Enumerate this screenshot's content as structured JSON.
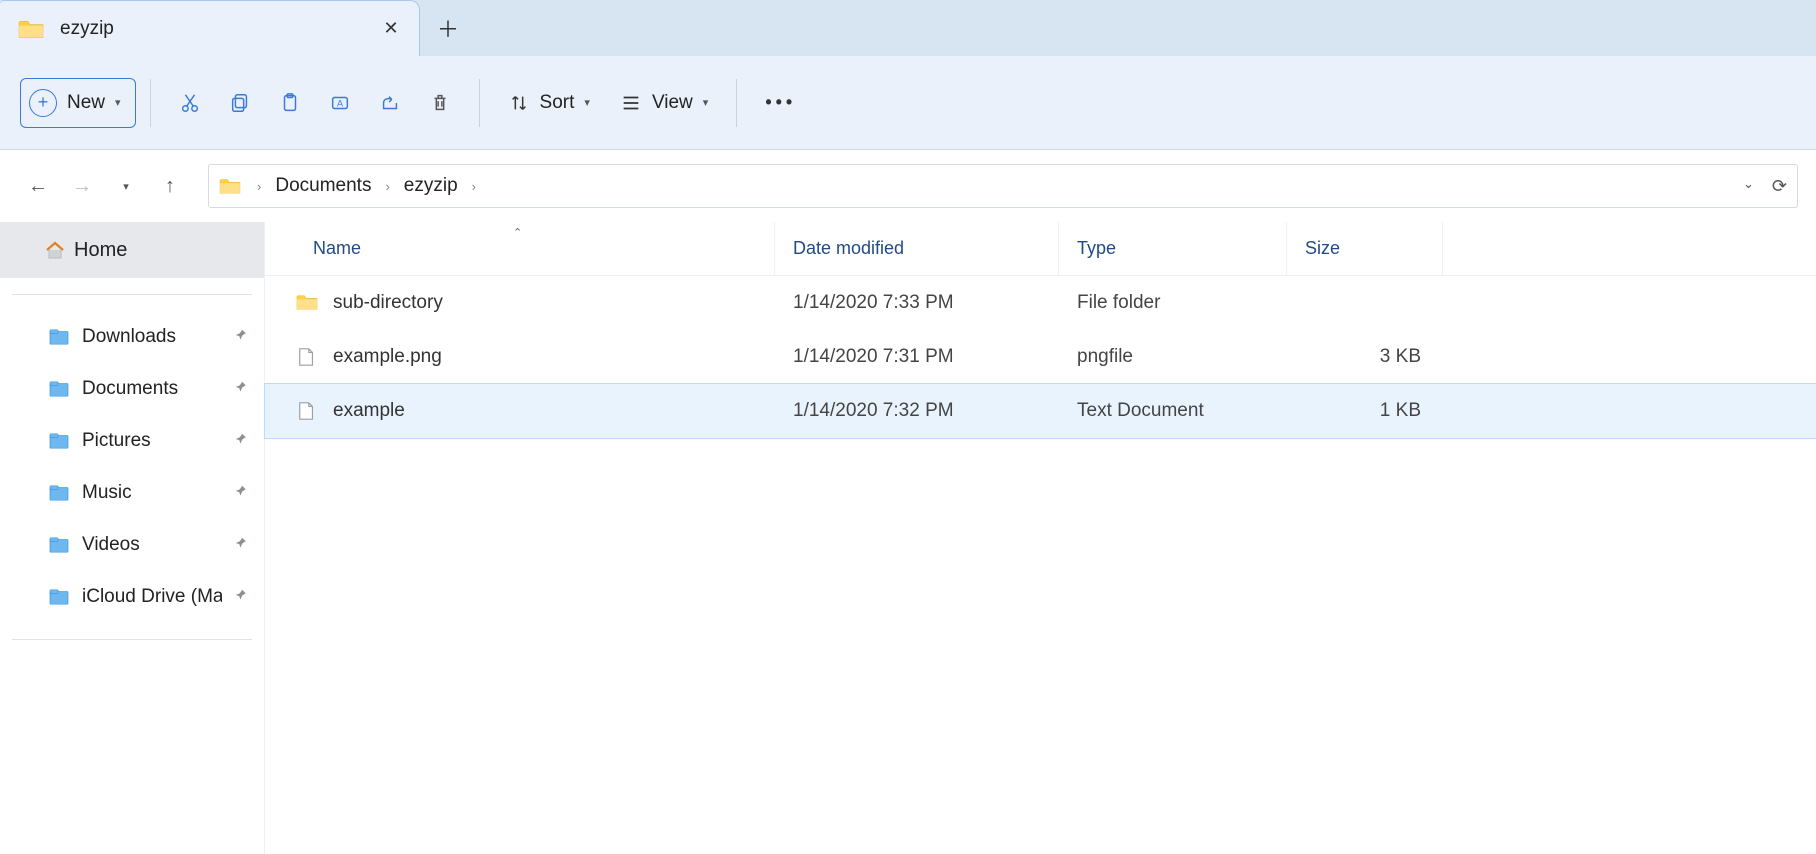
{
  "tab": {
    "title": "ezyzip"
  },
  "toolbar": {
    "new_label": "New",
    "sort_label": "Sort",
    "view_label": "View"
  },
  "breadcrumb": {
    "items": [
      "Documents",
      "ezyzip"
    ]
  },
  "sidebar": {
    "home_label": "Home",
    "items": [
      {
        "label": "Downloads"
      },
      {
        "label": "Documents"
      },
      {
        "label": "Pictures"
      },
      {
        "label": "Music"
      },
      {
        "label": "Videos"
      },
      {
        "label": "iCloud Drive (Ma"
      }
    ]
  },
  "columns": {
    "name": "Name",
    "date": "Date modified",
    "type": "Type",
    "size": "Size"
  },
  "files": [
    {
      "icon": "folder",
      "name": "sub-directory",
      "date": "1/14/2020 7:33 PM",
      "type": "File folder",
      "size": ""
    },
    {
      "icon": "file",
      "name": "example.png",
      "date": "1/14/2020 7:31 PM",
      "type": "pngfile",
      "size": "3 KB"
    },
    {
      "icon": "file",
      "name": "example",
      "date": "1/14/2020 7:32 PM",
      "type": "Text Document",
      "size": "1 KB",
      "selected": true
    }
  ]
}
